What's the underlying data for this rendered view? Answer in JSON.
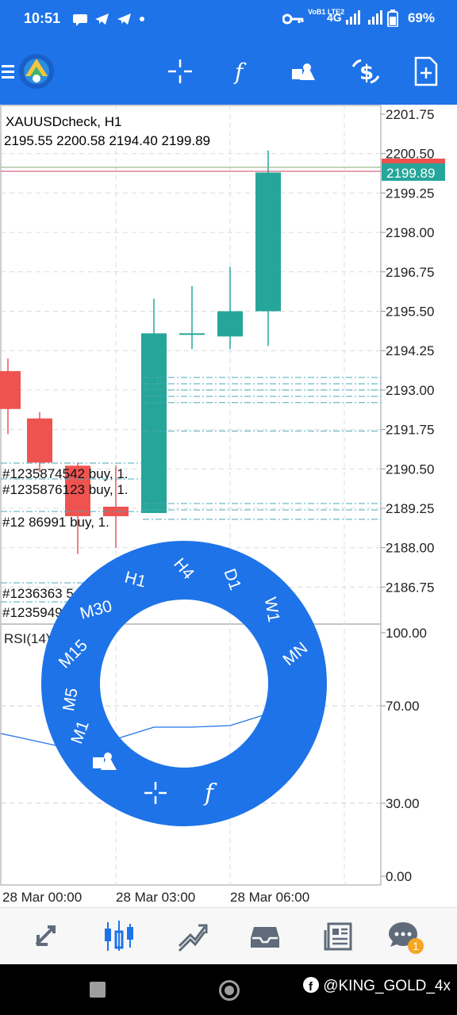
{
  "status_bar": {
    "time": "10:51",
    "network_tag": "VoB1 LTE2",
    "network_type": "4G",
    "battery": "69%",
    "icons": [
      "chat-bubble-icon",
      "telegram-icon",
      "telegram-icon",
      "dot-icon",
      "key-icon",
      "signal-icon",
      "signal-icon",
      "battery-icon"
    ]
  },
  "toolbar": {
    "icons": [
      "menu-icon",
      "app-logo-icon",
      "crosshair-icon",
      "indicator-f-icon",
      "objects-icon",
      "dollar-refresh-icon",
      "add-document-icon"
    ]
  },
  "chart": {
    "symbol_line": "XAUUSDcheck, H1",
    "ohlc_line": "2195.55 2200.58 2194.40 2199.89",
    "current_price": "2199.89",
    "price_ticks": [
      "2201.75",
      "2200.50",
      "2199.25",
      "2198.00",
      "2196.75",
      "2195.50",
      "2194.25",
      "2193.00",
      "2191.75",
      "2190.50",
      "2189.25",
      "2188.00",
      "2186.75"
    ],
    "time_labels": [
      "28 Mar 00:00",
      "28 Mar 03:00",
      "28 Mar 06:00"
    ],
    "order_labels": [
      "#1235874542 buy, 1.",
      "#1235876123 buy, 1.",
      "#12    86991 buy, 1.",
      "#1236363    5 buy, 1.",
      "#1235949      buy, 1.00"
    ],
    "bull_color": "#26a69a",
    "bear_color": "#ef5350"
  },
  "rsi": {
    "label": "RSI(14) 65.27",
    "ticks": [
      "100.00",
      "70.00",
      "30.00",
      "0.00"
    ]
  },
  "timeframe_menu": {
    "items": [
      "M1",
      "M5",
      "M15",
      "M30",
      "H1",
      "H4",
      "D1",
      "W1",
      "MN"
    ],
    "selected": "H1",
    "inner_icons": [
      "objects-icon",
      "crosshair-icon",
      "indicator-f-icon"
    ],
    "color": "#1e73e8"
  },
  "bottom_nav": {
    "items": [
      "quotes-icon",
      "chart-icon",
      "trade-icon",
      "history-icon",
      "news-icon",
      "chat-icon"
    ],
    "chat_badge": "1"
  },
  "system_nav": {
    "watermark": "@KING_GOLD_4x"
  }
}
